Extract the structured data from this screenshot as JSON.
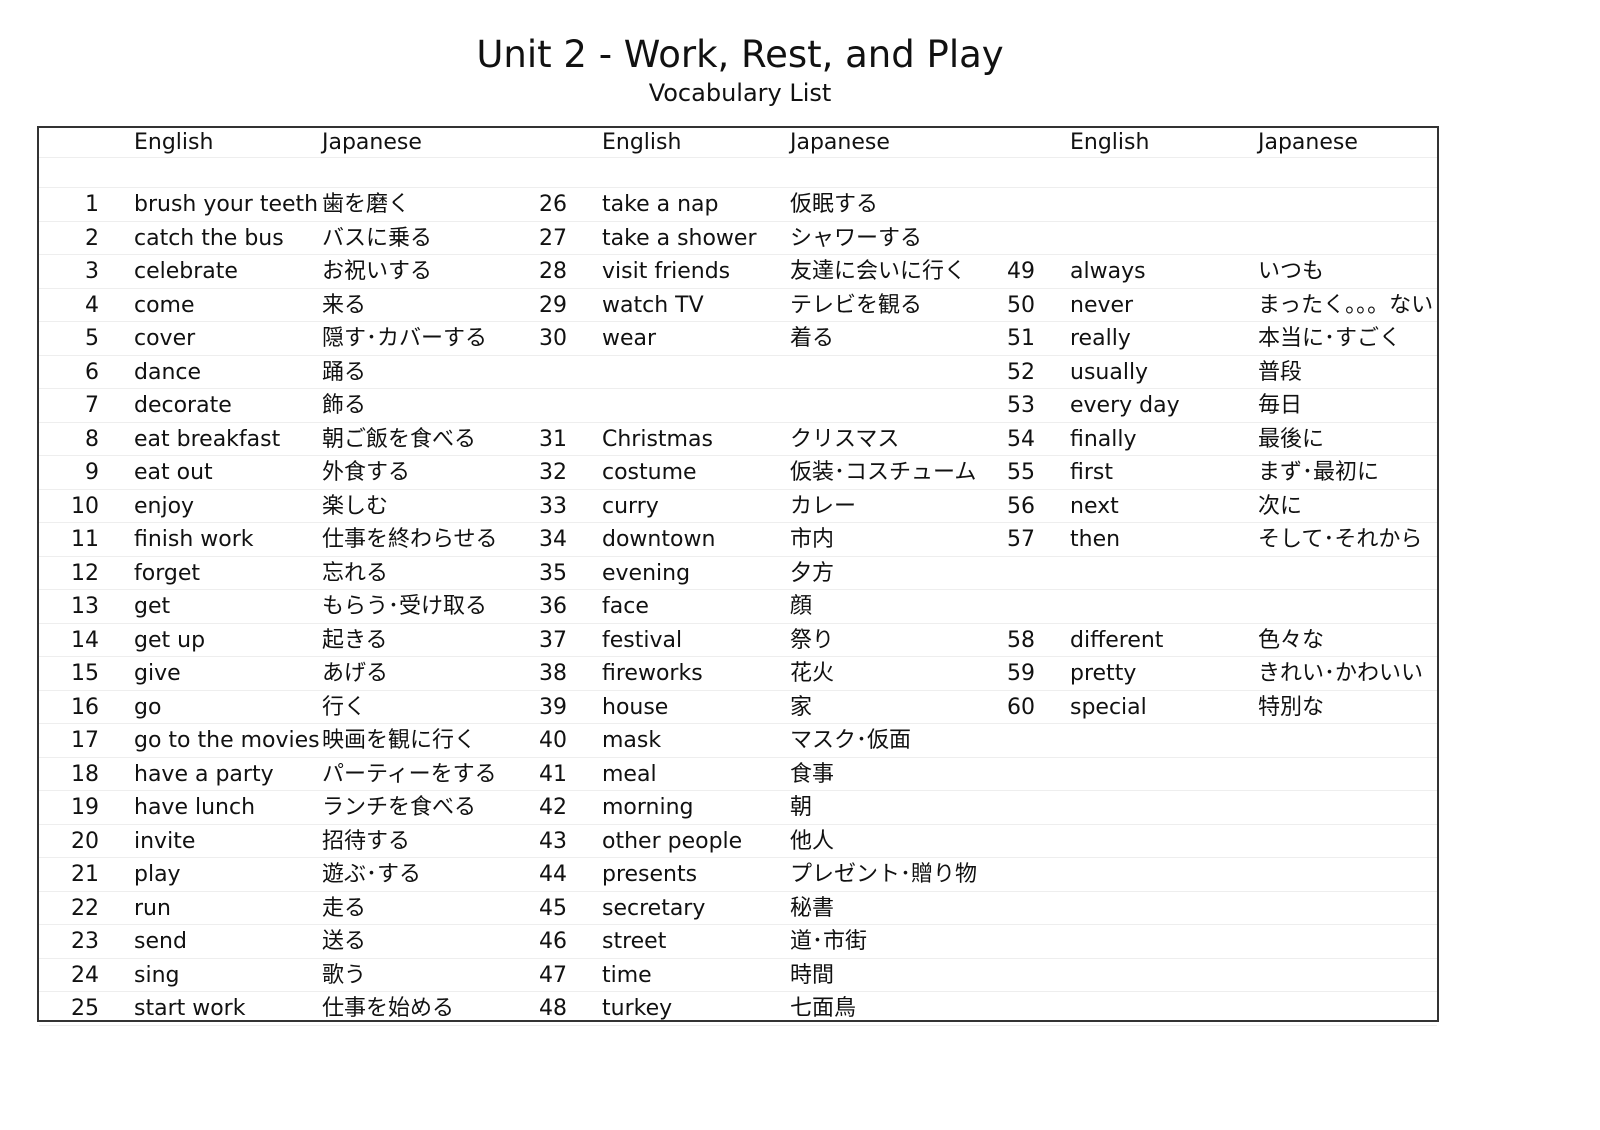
{
  "document": {
    "title": "Unit 2 - Work, Rest, and Play",
    "subtitle": "Vocabulary List"
  },
  "table": {
    "headers": [
      {
        "english": "English",
        "japanese": "Japanese"
      },
      {
        "english": "English",
        "japanese": "Japanese"
      },
      {
        "english": "English",
        "japanese": "Japanese"
      }
    ],
    "rows": [
      [
        {
          "n": "1",
          "en": "brush your teeth",
          "ja": "歯を磨く"
        },
        {
          "n": "26",
          "en": "take a nap",
          "ja": "仮眠する"
        },
        {
          "n": "",
          "en": "",
          "ja": ""
        }
      ],
      [
        {
          "n": "2",
          "en": "catch the bus",
          "ja": "バスに乗る"
        },
        {
          "n": "27",
          "en": "take a shower",
          "ja": "シャワーする"
        },
        {
          "n": "",
          "en": "",
          "ja": ""
        }
      ],
      [
        {
          "n": "3",
          "en": "celebrate",
          "ja": "お祝いする"
        },
        {
          "n": "28",
          "en": "visit friends",
          "ja": "友達に会いに行く"
        },
        {
          "n": "49",
          "en": "always",
          "ja": "いつも"
        }
      ],
      [
        {
          "n": "4",
          "en": "come",
          "ja": "来る"
        },
        {
          "n": "29",
          "en": "watch TV",
          "ja": "テレビを観る"
        },
        {
          "n": "50",
          "en": "never",
          "ja": "まったく。。。ない"
        }
      ],
      [
        {
          "n": "5",
          "en": "cover",
          "ja": "隠す･カバーする"
        },
        {
          "n": "30",
          "en": "wear",
          "ja": "着る"
        },
        {
          "n": "51",
          "en": "really",
          "ja": "本当に･すごく"
        }
      ],
      [
        {
          "n": "6",
          "en": "dance",
          "ja": "踊る"
        },
        {
          "n": "",
          "en": "",
          "ja": ""
        },
        {
          "n": "52",
          "en": "usually",
          "ja": "普段"
        }
      ],
      [
        {
          "n": "7",
          "en": "decorate",
          "ja": "飾る"
        },
        {
          "n": "",
          "en": "",
          "ja": ""
        },
        {
          "n": "53",
          "en": "every day",
          "ja": "毎日"
        }
      ],
      [
        {
          "n": "8",
          "en": "eat breakfast",
          "ja": "朝ご飯を食べる"
        },
        {
          "n": "31",
          "en": "Christmas",
          "ja": "クリスマス"
        },
        {
          "n": "54",
          "en": "finally",
          "ja": "最後に"
        }
      ],
      [
        {
          "n": "9",
          "en": "eat out",
          "ja": "外食する"
        },
        {
          "n": "32",
          "en": "costume",
          "ja": "仮装･コスチューム"
        },
        {
          "n": "55",
          "en": "first",
          "ja": "まず･最初に"
        }
      ],
      [
        {
          "n": "10",
          "en": "enjoy",
          "ja": "楽しむ"
        },
        {
          "n": "33",
          "en": "curry",
          "ja": "カレー"
        },
        {
          "n": "56",
          "en": "next",
          "ja": "次に"
        }
      ],
      [
        {
          "n": "11",
          "en": "finish work",
          "ja": "仕事を終わらせる"
        },
        {
          "n": "34",
          "en": "downtown",
          "ja": "市内"
        },
        {
          "n": "57",
          "en": "then",
          "ja": "そして･それから"
        }
      ],
      [
        {
          "n": "12",
          "en": "forget",
          "ja": "忘れる"
        },
        {
          "n": "35",
          "en": "evening",
          "ja": "夕方"
        },
        {
          "n": "",
          "en": "",
          "ja": ""
        }
      ],
      [
        {
          "n": "13",
          "en": "get",
          "ja": "もらう･受け取る"
        },
        {
          "n": "36",
          "en": "face",
          "ja": "顔"
        },
        {
          "n": "",
          "en": "",
          "ja": ""
        }
      ],
      [
        {
          "n": "14",
          "en": "get up",
          "ja": "起きる"
        },
        {
          "n": "37",
          "en": "festival",
          "ja": "祭り"
        },
        {
          "n": "58",
          "en": "different",
          "ja": "色々な"
        }
      ],
      [
        {
          "n": "15",
          "en": "give",
          "ja": "あげる"
        },
        {
          "n": "38",
          "en": "fireworks",
          "ja": "花火"
        },
        {
          "n": "59",
          "en": "pretty",
          "ja": "きれい･かわいい"
        }
      ],
      [
        {
          "n": "16",
          "en": "go",
          "ja": "行く"
        },
        {
          "n": "39",
          "en": "house",
          "ja": "家"
        },
        {
          "n": "60",
          "en": "special",
          "ja": "特別な"
        }
      ],
      [
        {
          "n": "17",
          "en": "go to the movies",
          "ja": "映画を観に行く"
        },
        {
          "n": "40",
          "en": "mask",
          "ja": "マスク･仮面"
        },
        {
          "n": "",
          "en": "",
          "ja": ""
        }
      ],
      [
        {
          "n": "18",
          "en": "have a party",
          "ja": "パーティーをする"
        },
        {
          "n": "41",
          "en": "meal",
          "ja": "食事"
        },
        {
          "n": "",
          "en": "",
          "ja": ""
        }
      ],
      [
        {
          "n": "19",
          "en": "have lunch",
          "ja": "ランチを食べる"
        },
        {
          "n": "42",
          "en": "morning",
          "ja": "朝"
        },
        {
          "n": "",
          "en": "",
          "ja": ""
        }
      ],
      [
        {
          "n": "20",
          "en": "invite",
          "ja": "招待する"
        },
        {
          "n": "43",
          "en": "other people",
          "ja": "他人"
        },
        {
          "n": "",
          "en": "",
          "ja": ""
        }
      ],
      [
        {
          "n": "21",
          "en": "play",
          "ja": "遊ぶ･する"
        },
        {
          "n": "44",
          "en": "presents",
          "ja": "プレゼント･贈り物"
        },
        {
          "n": "",
          "en": "",
          "ja": ""
        }
      ],
      [
        {
          "n": "22",
          "en": "run",
          "ja": "走る"
        },
        {
          "n": "45",
          "en": "secretary",
          "ja": "秘書"
        },
        {
          "n": "",
          "en": "",
          "ja": ""
        }
      ],
      [
        {
          "n": "23",
          "en": "send",
          "ja": "送る"
        },
        {
          "n": "46",
          "en": "street",
          "ja": "道･市街"
        },
        {
          "n": "",
          "en": "",
          "ja": ""
        }
      ],
      [
        {
          "n": "24",
          "en": "sing",
          "ja": "歌う"
        },
        {
          "n": "47",
          "en": "time",
          "ja": "時間"
        },
        {
          "n": "",
          "en": "",
          "ja": ""
        }
      ],
      [
        {
          "n": "25",
          "en": "start work",
          "ja": "仕事を始める"
        },
        {
          "n": "48",
          "en": "turkey",
          "ja": "七面鳥"
        },
        {
          "n": "",
          "en": "",
          "ja": ""
        }
      ]
    ]
  }
}
